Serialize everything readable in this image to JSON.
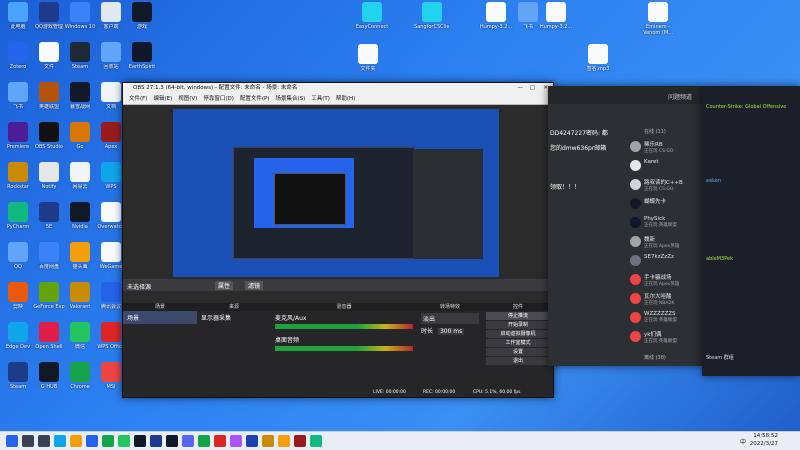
{
  "desktop_icons": [
    {
      "label": "此电脑",
      "color": "#4aa3ff"
    },
    {
      "label": "QQ游戏管理",
      "color": "#1e3a8a"
    },
    {
      "label": "Windows 10",
      "color": "#3b82f6"
    },
    {
      "label": "客户端",
      "color": "#e2e8f0"
    },
    {
      "label": "游戏",
      "color": "#111827"
    },
    {
      "label": "Zotero",
      "color": "#2563eb"
    },
    {
      "label": "文件",
      "color": "#f8fafc"
    },
    {
      "label": "Steam",
      "color": "#1f2937"
    },
    {
      "label": "回收站",
      "color": "#60a5fa"
    },
    {
      "label": "EarthSpirit",
      "color": "#0f172a"
    },
    {
      "label": "飞书",
      "color": "#60a5fa"
    },
    {
      "label": "英雄联盟",
      "color": "#b45309"
    },
    {
      "label": "暴雪战网",
      "color": "#111827"
    },
    {
      "label": "文档",
      "color": "#f1f5f9"
    },
    {
      "label": "图片",
      "color": "#ec4899"
    },
    {
      "label": "Premiere",
      "color": "#4c1d95"
    },
    {
      "label": "OBS Studio",
      "color": "#111"
    },
    {
      "label": "Go",
      "color": "#d97706"
    },
    {
      "label": "Apex",
      "color": "#991b1b"
    },
    {
      "label": "Edge",
      "color": "#0ea5e9"
    },
    {
      "label": "Rockstar",
      "color": "#ca8a04"
    },
    {
      "label": "Notify",
      "color": "#e5e7eb"
    },
    {
      "label": "网易云",
      "color": "#f1f5f9"
    },
    {
      "label": "WPS",
      "color": "#0ea5e9"
    },
    {
      "label": "GeForce",
      "color": "#16a34a"
    },
    {
      "label": "PyCharm",
      "color": "#10b981"
    },
    {
      "label": "5E",
      "color": "#1e3a8a"
    },
    {
      "label": "Nvidia",
      "color": "#111827"
    },
    {
      "label": "Overwatch",
      "color": "#f8fafc"
    },
    {
      "label": "PUBG",
      "color": "#eab308"
    },
    {
      "label": "QQ",
      "color": "#60a5fa"
    },
    {
      "label": "百度网盘",
      "color": "#3b82f6"
    },
    {
      "label": "猫头鹰",
      "color": "#f59e0b"
    },
    {
      "label": "WeGame",
      "color": "#f8fafc"
    },
    {
      "label": "QQ音乐",
      "color": "#111827"
    },
    {
      "label": "剪映",
      "color": "#ea580c"
    },
    {
      "label": "GeForce Exp",
      "color": "#65a30d"
    },
    {
      "label": "Valorant",
      "color": "#ca8a04"
    },
    {
      "label": "腾讯会议",
      "color": "#2563eb"
    },
    {
      "label": "网易",
      "color": "#fbbf24"
    },
    {
      "label": "Edge Dev",
      "color": "#0ea5e9"
    },
    {
      "label": "Open Shell",
      "color": "#e11d48"
    },
    {
      "label": "微信",
      "color": "#22c55e"
    },
    {
      "label": "WPS Office",
      "color": "#dc2626"
    },
    {
      "label": "爱奇艺",
      "color": "#2563eb"
    },
    {
      "label": "Steam",
      "color": "#1e3a8a"
    },
    {
      "label": "G HUB",
      "color": "#111827"
    },
    {
      "label": "Chrome",
      "color": "#16a34a"
    },
    {
      "label": "MSI",
      "color": "#ef4444"
    },
    {
      "label": "Uplay",
      "color": "#f1f5f9"
    }
  ],
  "top_icons": [
    {
      "label": "EasyConnect",
      "color": "#22d3ee"
    },
    {
      "label": "SangforCSClient",
      "color": "#22d3ee"
    },
    {
      "label": "Humpy-3.2...",
      "color": "#f8fafc"
    },
    {
      "label": "Humpy-3.2...",
      "color": "#f8fafc"
    },
    {
      "label": "飞书",
      "color": "#60a5fa"
    },
    {
      "label": "Eminem - Venom (M...",
      "color": "#f8fafc"
    },
    {
      "label": "签名.mp3",
      "color": "#f8fafc"
    },
    {
      "label": "文件夹",
      "color": "#f8fafc"
    }
  ],
  "obs": {
    "title": "OBS 27.1.3 (64-bit, windows) - 配置文件: 未命名 - 场景: 未命名",
    "menu": [
      "文件(F)",
      "编辑(E)",
      "视图(V)",
      "停靠窗口(D)",
      "配置文件(P)",
      "场景集合(S)",
      "工具(T)",
      "帮助(H)"
    ],
    "source_bar": "未选择源",
    "props_btn": "属性",
    "filters_btn": "滤镜",
    "docks": [
      {
        "title": "场景",
        "items": [
          "场景"
        ]
      },
      {
        "title": "来源",
        "items": [
          "显示器采集"
        ]
      },
      {
        "title": "混音器",
        "items": [
          "麦克风/Aux",
          "桌面音频"
        ]
      },
      {
        "title": "转场特效",
        "items": [
          "淡出",
          "时长",
          "300 ms"
        ]
      },
      {
        "title": "控件",
        "items": [
          "停止推流",
          "开始录制",
          "启动虚拟摄像机",
          "工作室模式",
          "设置",
          "退出"
        ]
      }
    ],
    "status": {
      "live": "LIVE: 00:00:00",
      "rec": "REC: 00:00:00",
      "cpu": "CPU: 5.1%, 60.00 fps"
    }
  },
  "chat": {
    "header": "问题频道",
    "messages": [
      "DD4247227密码: 都",
      "您的dmw636pr邮箱",
      "领取！！！"
    ],
    "online_label": "在线 (11)",
    "offline_label": "离线 (38)",
    "members": [
      {
        "name": "稀乐RB",
        "status": "正在玩 CS:GO",
        "color": "#9ca3af"
      },
      {
        "name": "Karet",
        "status": "",
        "color": "#e5e7eb"
      },
      {
        "name": "路叔读的C++B",
        "status": "正在玩 CS:GO",
        "color": "#d1d5db"
      },
      {
        "name": "蝴蝶先卡",
        "status": "",
        "color": "#111827"
      },
      {
        "name": "PhySick",
        "status": "正在玩 英雄联盟",
        "color": "#0f172a"
      },
      {
        "name": "魏新",
        "status": "正在玩 Apex英雄",
        "color": "#a3a3a3"
      },
      {
        "name": "SE7kzZzZz",
        "status": "",
        "color": "#6b7280"
      },
      {
        "name": "手卡骗战场",
        "status": "正在玩 Apex英雄",
        "color": "#ef4444"
      },
      {
        "name": "瓦尔大哈酸",
        "status": "正在玩 NBA2K",
        "color": "#ef4444"
      },
      {
        "name": "WZZZZZZS",
        "status": "正在玩 英雄联盟",
        "color": "#ef4444"
      },
      {
        "name": "yk们偶",
        "status": "正在玩 英雄联盟",
        "color": "#ef4444"
      }
    ]
  },
  "steam": {
    "header": "Counter-Strike: Global Offensive",
    "lines": [
      "eeken",
      "ableM3Pek",
      "Steam 群组"
    ]
  },
  "taskbar": {
    "time": "14:58:52",
    "date": "2022/3/27",
    "lang": "中",
    "icons": [
      {
        "name": "start-icon",
        "color": "#2563eb"
      },
      {
        "name": "search-icon",
        "color": "#374151"
      },
      {
        "name": "taskview-icon",
        "color": "#374151"
      },
      {
        "name": "edge-icon",
        "color": "#0ea5e9"
      },
      {
        "name": "explorer-icon",
        "color": "#f59e0b"
      },
      {
        "name": "store-icon",
        "color": "#2563eb"
      },
      {
        "name": "chrome-icon",
        "color": "#16a34a"
      },
      {
        "name": "wechat-icon",
        "color": "#22c55e"
      },
      {
        "name": "qq-icon",
        "color": "#111827"
      },
      {
        "name": "steam-icon",
        "color": "#1e3a8a"
      },
      {
        "name": "obs-icon",
        "color": "#111827"
      },
      {
        "name": "discord-icon",
        "color": "#5865f2"
      },
      {
        "name": "kook-icon",
        "color": "#16a34a"
      },
      {
        "name": "netease-icon",
        "color": "#dc2626"
      },
      {
        "name": "game-icon",
        "color": "#a855f7"
      },
      {
        "name": "steam2-icon",
        "color": "#1e40af"
      },
      {
        "name": "csgo-icon",
        "color": "#ca8a04"
      },
      {
        "name": "folder-icon",
        "color": "#f59e0b"
      },
      {
        "name": "apex-icon",
        "color": "#991b1b"
      },
      {
        "name": "music-icon",
        "color": "#10b981"
      }
    ]
  }
}
